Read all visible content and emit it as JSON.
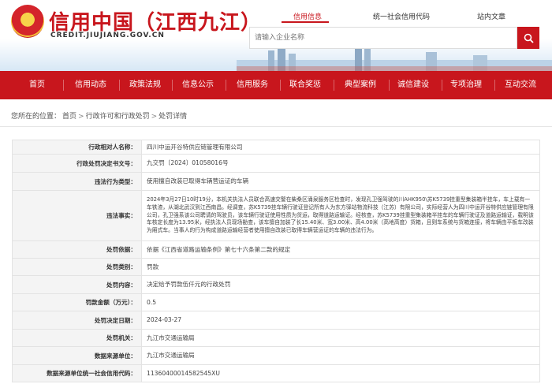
{
  "site": {
    "emblem_glyph": "★",
    "title": "信用中国（江西九江）",
    "domain": "CREDIT.JIUJIANG.GOV.CN"
  },
  "top_links": [
    {
      "label": "信用信息",
      "active": true
    },
    {
      "label": "统一社会信用代码",
      "active": false
    },
    {
      "label": "站内文章",
      "active": false
    }
  ],
  "search": {
    "placeholder": "请输入企业名称",
    "icon": "search-icon"
  },
  "nav": [
    {
      "label": "首页"
    },
    {
      "label": "信用动态"
    },
    {
      "label": "政策法规"
    },
    {
      "label": "信息公示"
    },
    {
      "label": "信用服务"
    },
    {
      "label": "联合奖惩"
    },
    {
      "label": "典型案例"
    },
    {
      "label": "诚信建设"
    },
    {
      "label": "专项治理"
    },
    {
      "label": "互动交流"
    }
  ],
  "breadcrumb": {
    "prefix": "您所在的位置：",
    "items": [
      "首页",
      "行政许可和行政处罚",
      "处罚详情"
    ],
    "separator": ">"
  },
  "details": [
    {
      "key": "行政相对人名称：",
      "value": "四川中运开谷特供应链管理有限公司"
    },
    {
      "key": "行政处罚决定书文号：",
      "value": "九交罚〔2024〕01058016号"
    },
    {
      "key": "违法行为类型：",
      "value": "使用擅自改装已取得车辆营运证的车辆"
    },
    {
      "key": "违法事实：",
      "value": "2024年3月27日10时19分，本机关执法人员联合高速交警在柴桑区涌泉服务区检查时，发现孔卫强驾驶的川AHK950\\苏K5739挂重型集装箱半挂车，车上载有一车铁渣，从湖北武汉到江西南昌。经调查，苏K5739挂车辆行驶证登记所有人为东方驿站物流科技（江苏）有限公司，实际经营人为四川中运开谷特供应链管理有限公司，孔卫强系该公司聘请的驾驶员，该车辆行驶证使用性质为货运，取得道路运输证。经核查，苏K5739挂重型集装箱半挂车的车辆行驶证及道路运输证，载明该车核定长度为13.95米，经执法人员现场勘查，该车擅自加装了长15.40米、宽3.00米、高4.00米（高地高度）货箱，且则车系统与货箱连接，将车辆由平板车改装为厢式车。当事人的行为构成道路运输经营者使用擅自改装已取得车辆营运证的车辆的违法行为。"
    },
    {
      "key": "处罚依据：",
      "value": "依据《江西省道路运输条例》第七十六条第二款的规定"
    },
    {
      "key": "处罚类别：",
      "value": "罚款"
    },
    {
      "key": "处罚内容：",
      "value": "决定给予罚款伍仟元的行政处罚"
    },
    {
      "key": "罚款金额（万元）：",
      "value": "0.5"
    },
    {
      "key": "处罚决定日期：",
      "value": "2024-03-27"
    },
    {
      "key": "处罚机关：",
      "value": "九江市交通运输局"
    },
    {
      "key": "数据来源单位：",
      "value": "九江市交通运输局"
    },
    {
      "key": "数据来源单位统一社会信用代码：",
      "value": "11360400014582545XU"
    }
  ],
  "colors": {
    "brand_red": "#c8161d"
  }
}
